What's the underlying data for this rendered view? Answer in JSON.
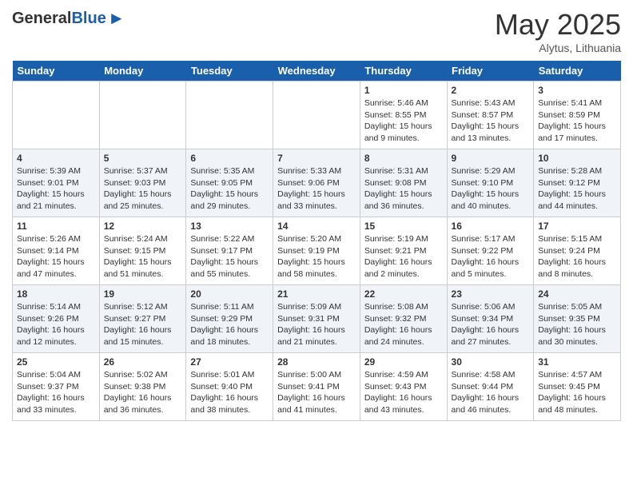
{
  "header": {
    "logo_general": "General",
    "logo_blue": "Blue",
    "month": "May 2025",
    "location": "Alytus, Lithuania"
  },
  "weekdays": [
    "Sunday",
    "Monday",
    "Tuesday",
    "Wednesday",
    "Thursday",
    "Friday",
    "Saturday"
  ],
  "weeks": [
    [
      {
        "day": "",
        "info": ""
      },
      {
        "day": "",
        "info": ""
      },
      {
        "day": "",
        "info": ""
      },
      {
        "day": "",
        "info": ""
      },
      {
        "day": "1",
        "info": "Sunrise: 5:46 AM\nSunset: 8:55 PM\nDaylight: 15 hours\nand 9 minutes."
      },
      {
        "day": "2",
        "info": "Sunrise: 5:43 AM\nSunset: 8:57 PM\nDaylight: 15 hours\nand 13 minutes."
      },
      {
        "day": "3",
        "info": "Sunrise: 5:41 AM\nSunset: 8:59 PM\nDaylight: 15 hours\nand 17 minutes."
      }
    ],
    [
      {
        "day": "4",
        "info": "Sunrise: 5:39 AM\nSunset: 9:01 PM\nDaylight: 15 hours\nand 21 minutes."
      },
      {
        "day": "5",
        "info": "Sunrise: 5:37 AM\nSunset: 9:03 PM\nDaylight: 15 hours\nand 25 minutes."
      },
      {
        "day": "6",
        "info": "Sunrise: 5:35 AM\nSunset: 9:05 PM\nDaylight: 15 hours\nand 29 minutes."
      },
      {
        "day": "7",
        "info": "Sunrise: 5:33 AM\nSunset: 9:06 PM\nDaylight: 15 hours\nand 33 minutes."
      },
      {
        "day": "8",
        "info": "Sunrise: 5:31 AM\nSunset: 9:08 PM\nDaylight: 15 hours\nand 36 minutes."
      },
      {
        "day": "9",
        "info": "Sunrise: 5:29 AM\nSunset: 9:10 PM\nDaylight: 15 hours\nand 40 minutes."
      },
      {
        "day": "10",
        "info": "Sunrise: 5:28 AM\nSunset: 9:12 PM\nDaylight: 15 hours\nand 44 minutes."
      }
    ],
    [
      {
        "day": "11",
        "info": "Sunrise: 5:26 AM\nSunset: 9:14 PM\nDaylight: 15 hours\nand 47 minutes."
      },
      {
        "day": "12",
        "info": "Sunrise: 5:24 AM\nSunset: 9:15 PM\nDaylight: 15 hours\nand 51 minutes."
      },
      {
        "day": "13",
        "info": "Sunrise: 5:22 AM\nSunset: 9:17 PM\nDaylight: 15 hours\nand 55 minutes."
      },
      {
        "day": "14",
        "info": "Sunrise: 5:20 AM\nSunset: 9:19 PM\nDaylight: 15 hours\nand 58 minutes."
      },
      {
        "day": "15",
        "info": "Sunrise: 5:19 AM\nSunset: 9:21 PM\nDaylight: 16 hours\nand 2 minutes."
      },
      {
        "day": "16",
        "info": "Sunrise: 5:17 AM\nSunset: 9:22 PM\nDaylight: 16 hours\nand 5 minutes."
      },
      {
        "day": "17",
        "info": "Sunrise: 5:15 AM\nSunset: 9:24 PM\nDaylight: 16 hours\nand 8 minutes."
      }
    ],
    [
      {
        "day": "18",
        "info": "Sunrise: 5:14 AM\nSunset: 9:26 PM\nDaylight: 16 hours\nand 12 minutes."
      },
      {
        "day": "19",
        "info": "Sunrise: 5:12 AM\nSunset: 9:27 PM\nDaylight: 16 hours\nand 15 minutes."
      },
      {
        "day": "20",
        "info": "Sunrise: 5:11 AM\nSunset: 9:29 PM\nDaylight: 16 hours\nand 18 minutes."
      },
      {
        "day": "21",
        "info": "Sunrise: 5:09 AM\nSunset: 9:31 PM\nDaylight: 16 hours\nand 21 minutes."
      },
      {
        "day": "22",
        "info": "Sunrise: 5:08 AM\nSunset: 9:32 PM\nDaylight: 16 hours\nand 24 minutes."
      },
      {
        "day": "23",
        "info": "Sunrise: 5:06 AM\nSunset: 9:34 PM\nDaylight: 16 hours\nand 27 minutes."
      },
      {
        "day": "24",
        "info": "Sunrise: 5:05 AM\nSunset: 9:35 PM\nDaylight: 16 hours\nand 30 minutes."
      }
    ],
    [
      {
        "day": "25",
        "info": "Sunrise: 5:04 AM\nSunset: 9:37 PM\nDaylight: 16 hours\nand 33 minutes."
      },
      {
        "day": "26",
        "info": "Sunrise: 5:02 AM\nSunset: 9:38 PM\nDaylight: 16 hours\nand 36 minutes."
      },
      {
        "day": "27",
        "info": "Sunrise: 5:01 AM\nSunset: 9:40 PM\nDaylight: 16 hours\nand 38 minutes."
      },
      {
        "day": "28",
        "info": "Sunrise: 5:00 AM\nSunset: 9:41 PM\nDaylight: 16 hours\nand 41 minutes."
      },
      {
        "day": "29",
        "info": "Sunrise: 4:59 AM\nSunset: 9:43 PM\nDaylight: 16 hours\nand 43 minutes."
      },
      {
        "day": "30",
        "info": "Sunrise: 4:58 AM\nSunset: 9:44 PM\nDaylight: 16 hours\nand 46 minutes."
      },
      {
        "day": "31",
        "info": "Sunrise: 4:57 AM\nSunset: 9:45 PM\nDaylight: 16 hours\nand 48 minutes."
      }
    ]
  ]
}
